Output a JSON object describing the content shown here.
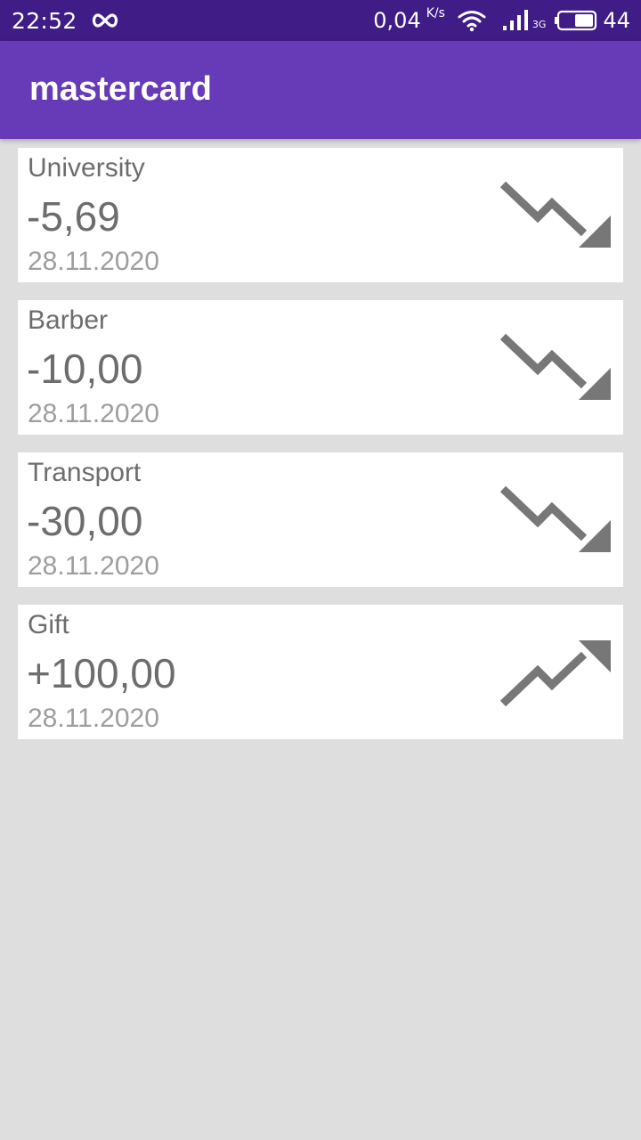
{
  "status_bar": {
    "time": "22:52",
    "infinity_icon": "infinity-icon",
    "speed": "0,04",
    "speed_unit": "K/s",
    "wifi_icon": "wifi-icon",
    "signal_icon": "cell-signal-icon",
    "network_type": "3G",
    "battery_icon": "battery-icon",
    "battery_level": "44"
  },
  "app_bar": {
    "title": "mastercard",
    "color": "#673ab7",
    "status_color": "#3f1c86"
  },
  "transactions": [
    {
      "category": "University",
      "amount": "-5,69",
      "date": "28.11.2020",
      "trend_icon": "trend-down-icon"
    },
    {
      "category": "Barber",
      "amount": "-10,00",
      "date": "28.11.2020",
      "trend_icon": "trend-down-icon"
    },
    {
      "category": "Transport",
      "amount": "-30,00",
      "date": "28.11.2020",
      "trend_icon": "trend-down-icon"
    },
    {
      "category": "Gift",
      "amount": "+100,00",
      "date": "28.11.2020",
      "trend_icon": "trend-up-icon"
    }
  ]
}
